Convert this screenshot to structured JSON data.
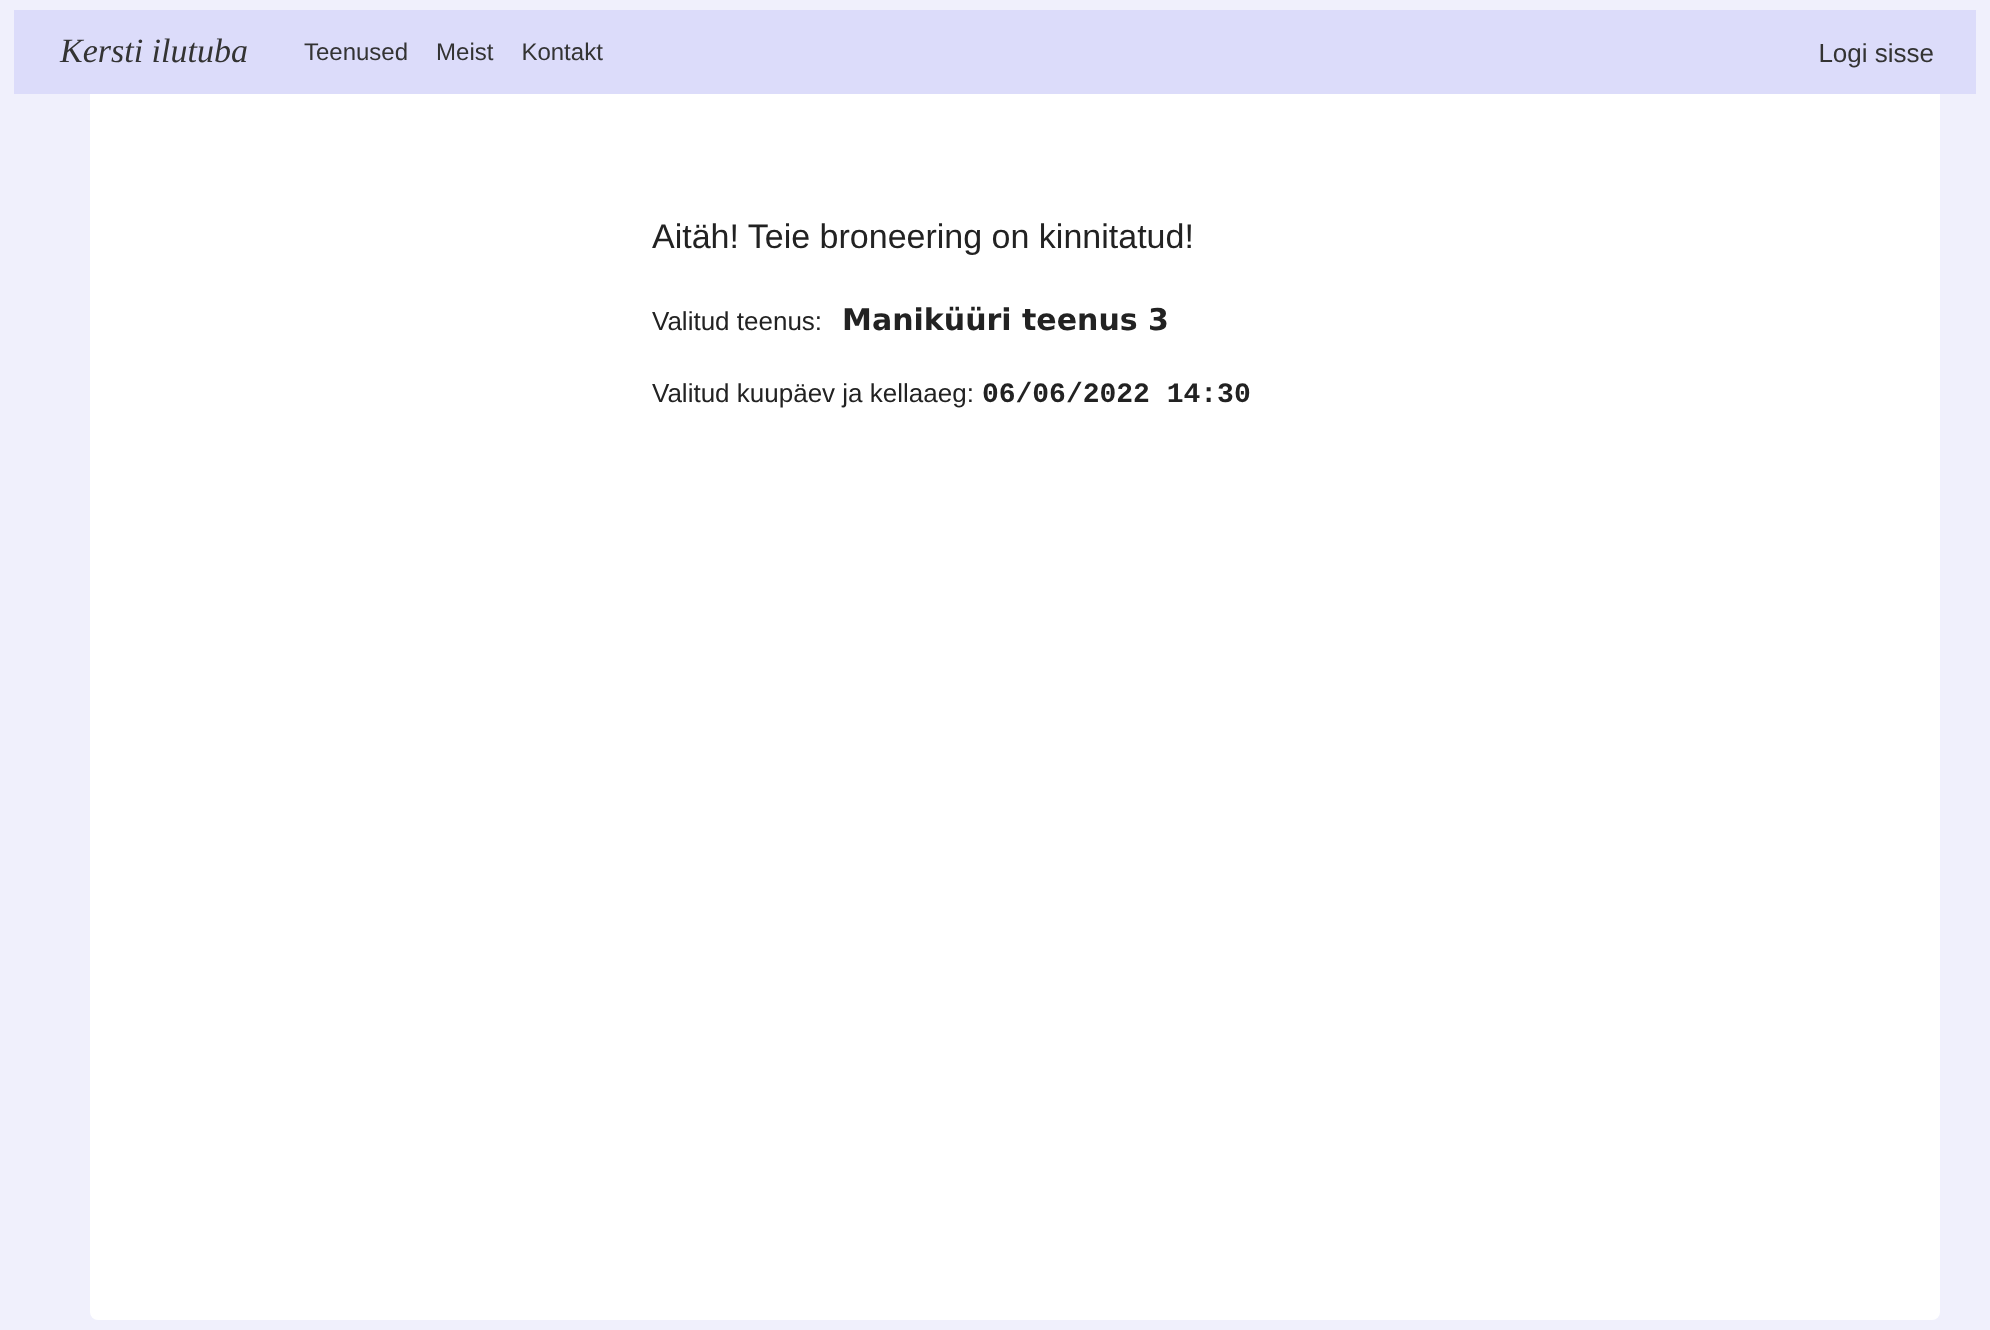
{
  "nav": {
    "logo": "Kersti ilutuba",
    "links": [
      "Teenused",
      "Meist",
      "Kontakt"
    ],
    "login": "Logi sisse"
  },
  "confirmation": {
    "heading": "Aitäh! Teie broneering on kinnitatud!",
    "details": [
      {
        "label": "Valitud teenus:",
        "value": "Maniküüri teenus 3",
        "kind": "service"
      },
      {
        "label": "Valitud kuupäev ja kellaaeg:",
        "value": "06/06/2022 14:30",
        "kind": "datetime"
      }
    ]
  }
}
